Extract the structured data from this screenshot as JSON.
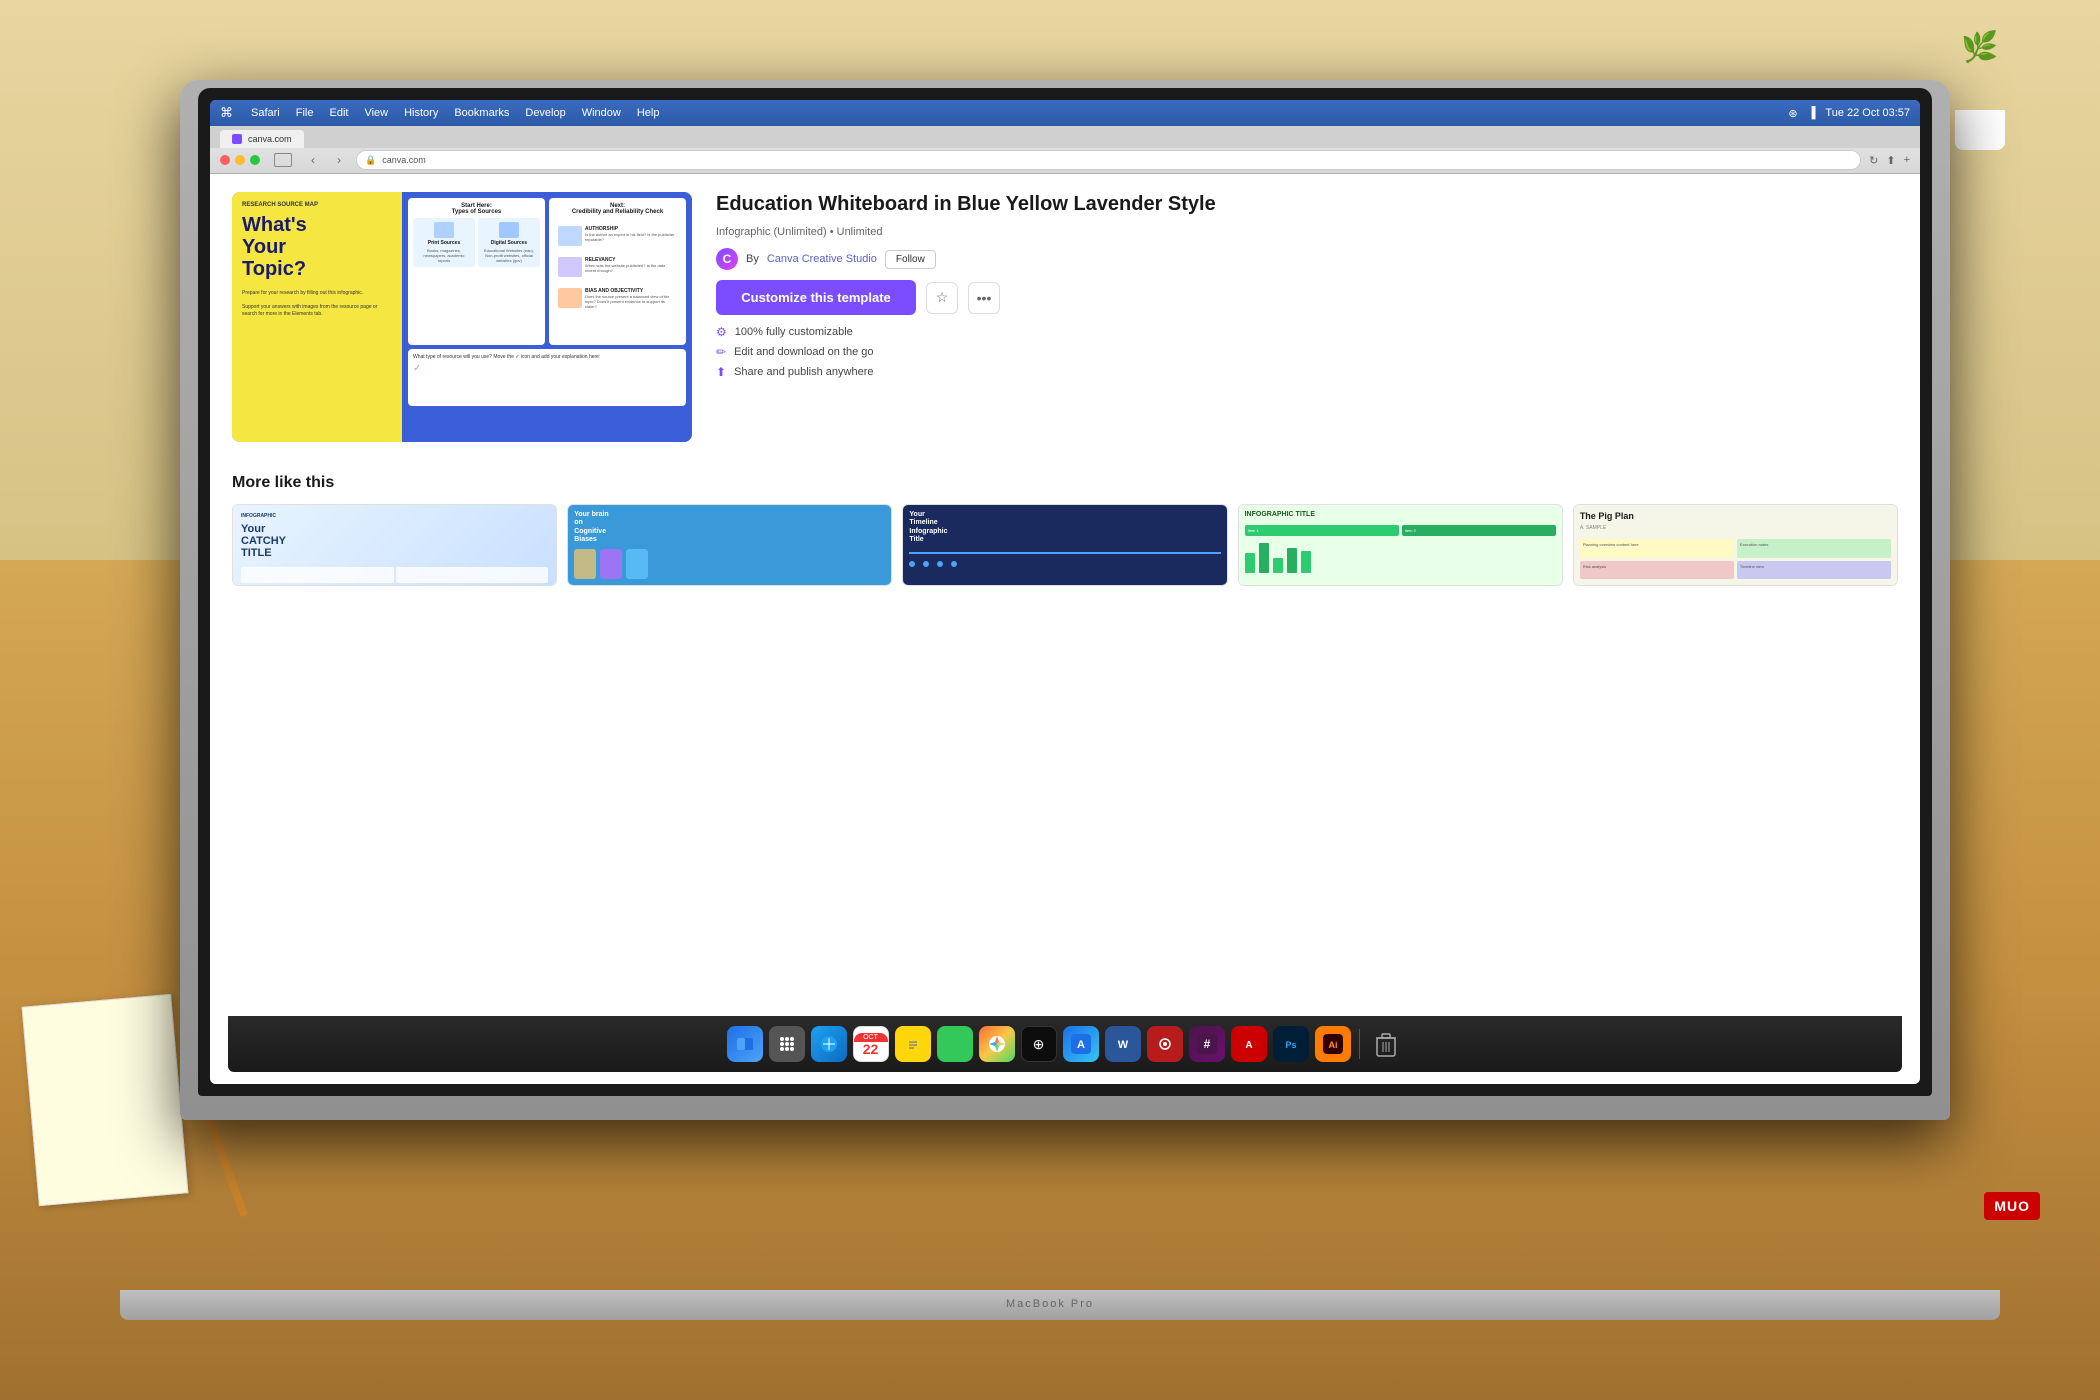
{
  "scene": {
    "background": "desk with notebook",
    "computer": "MacBook Pro"
  },
  "macos": {
    "menubar": {
      "items": [
        "Safari",
        "File",
        "Edit",
        "View",
        "History",
        "Bookmarks",
        "Develop",
        "Window",
        "Help"
      ],
      "time": "Tue 22 Oct  03:57"
    }
  },
  "browser": {
    "tab_title": "canva.com",
    "url": "canva.com",
    "nav": {
      "back": "‹",
      "forward": "›"
    }
  },
  "template": {
    "title": "Education Whiteboard in Blue Yellow Lavender Style",
    "meta": "Infographic (Unlimited) • Unlimited",
    "author": "Canva Creative Studio",
    "follow_label": "Follow",
    "customize_label": "Customize this template",
    "features": [
      "100% fully customizable",
      "Edit and download on the go",
      "Share and publish anywhere"
    ]
  },
  "infographic": {
    "research_label": "RESEARCH SOURCE MAP",
    "main_question": "What's Your Topic?",
    "body_text": "Prepare for your research by filling out this infographic. Support your answers with images from the resource page or search for more in the Elements tab.",
    "start_label": "Start Here: Types of Sources",
    "next_label": "Next: Credibility and Reliability Check",
    "print_label": "Print Sources",
    "digital_label": "Digital Sources",
    "authorship_label": "AUTHORSHIP",
    "relevancy_label": "RELEVANCY",
    "bias_label": "BIAS AND OBJECTIVITY"
  },
  "more_section": {
    "title": "More like this",
    "thumbnails": [
      {
        "label": "Your CATCHY TITLE",
        "type": "catchy"
      },
      {
        "label": "Your brain on Cognitive Biases",
        "type": "cognitive"
      },
      {
        "label": "Your Timeline Infographic Title",
        "type": "timeline"
      },
      {
        "label": "INFOGRAPHIC TITLE",
        "type": "green"
      },
      {
        "label": "The Pig Plan",
        "type": "pig"
      }
    ]
  },
  "dock": {
    "apps": [
      {
        "name": "Finder",
        "emoji": "🔵"
      },
      {
        "name": "Launchpad",
        "emoji": "⊞"
      },
      {
        "name": "Safari",
        "emoji": "🌐"
      },
      {
        "name": "Calendar",
        "emoji": "📅"
      },
      {
        "name": "Notes",
        "emoji": "📝"
      },
      {
        "name": "Messages",
        "emoji": "💬"
      },
      {
        "name": "Photos",
        "emoji": "🖼"
      },
      {
        "name": "ChatGPT",
        "emoji": "✦"
      },
      {
        "name": "App Store",
        "emoji": "A"
      },
      {
        "name": "Word",
        "emoji": "W"
      },
      {
        "name": "DaVinci Resolve",
        "emoji": "★"
      },
      {
        "name": "Slack",
        "emoji": "#"
      },
      {
        "name": "Acrobat",
        "emoji": "A"
      },
      {
        "name": "Photoshop",
        "emoji": "Ps"
      },
      {
        "name": "Illustrator",
        "emoji": "Ai"
      },
      {
        "name": "Trash",
        "emoji": "🗑"
      }
    ]
  },
  "muo": {
    "label": "MUO"
  }
}
